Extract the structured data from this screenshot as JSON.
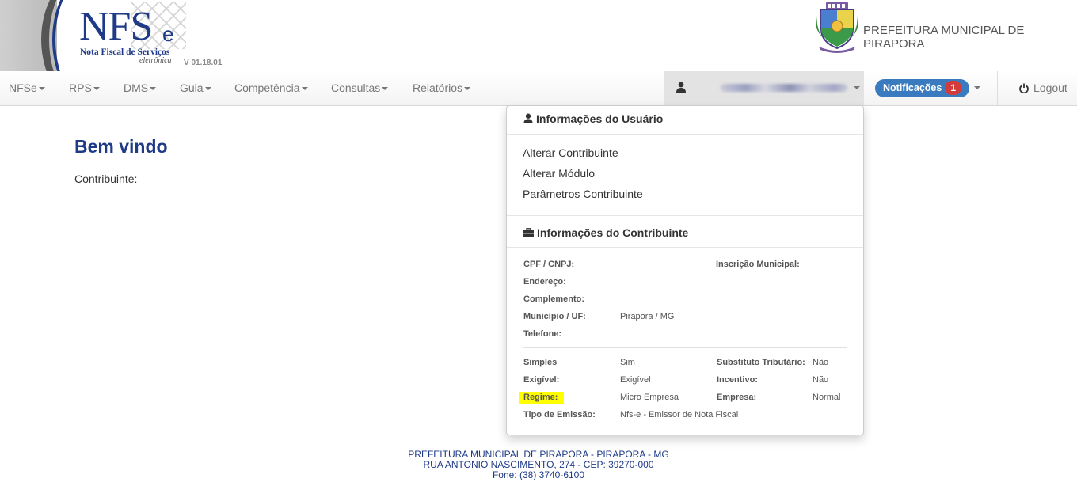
{
  "header": {
    "logo_main": "NFS",
    "logo_suffix": "e",
    "logo_subtitle": "Nota Fiscal de Serviços",
    "logo_subtitle2": "eletrônica",
    "version": "V 01.18.01",
    "prefeitura_title": "PREFEITURA MUNICIPAL DE PIRAPORA"
  },
  "navbar": {
    "items": [
      {
        "label": "NFSe"
      },
      {
        "label": "RPS"
      },
      {
        "label": "DMS"
      },
      {
        "label": "Guia"
      },
      {
        "label": "Competência"
      },
      {
        "label": "Consultas"
      },
      {
        "label": "Relatórios"
      }
    ],
    "notifications_label": "Notificações",
    "notifications_count": "1",
    "logout_label": "Logout"
  },
  "main": {
    "welcome": "Bem vindo",
    "contribuinte_label": "Contribuinte:"
  },
  "dropdown": {
    "user_header": "Informações do Usuário",
    "links": [
      {
        "label": "Alterar Contribuinte"
      },
      {
        "label": "Alterar Módulo"
      },
      {
        "label": "Parâmetros Contribuinte"
      }
    ],
    "contrib_header": "Informações do Contribuinte",
    "labels": {
      "cpf": "CPF / CNPJ:",
      "inscricao": "Inscrição Municipal:",
      "endereco": "Endereço:",
      "complemento": "Complemento:",
      "municipio": "Município / UF:",
      "telefone": "Telefone:",
      "simples": "Simples",
      "substituto": "Substituto Tributário:",
      "exigivel": "Exigível:",
      "incentivo": "Incentivo:",
      "regime": "Regime:",
      "empresa": "Empresa:",
      "tipo_emissao": "Tipo de Emissão:"
    },
    "values": {
      "municipio": "Pirapora / MG",
      "simples": "Sim",
      "substituto": "Não",
      "exigivel": "Exigível",
      "incentivo": "Não",
      "regime": "Micro Empresa",
      "empresa": "Normal",
      "tipo_emissao": "Nfs-e - Emissor de Nota Fiscal"
    }
  },
  "footer": {
    "line1": "PREFEITURA MUNICIPAL DE PIRAPORA - PIRAPORA - MG",
    "line2": "RUA ANTONIO NASCIMENTO, 274 - CEP: 39270-000",
    "line3": "Fone: (38) 3740-6100"
  },
  "colors": {
    "brand_blue": "#1f3b87",
    "notif_blue": "#3a7bbf",
    "badge_red": "#d33b3b",
    "highlight": "#ffff00"
  }
}
